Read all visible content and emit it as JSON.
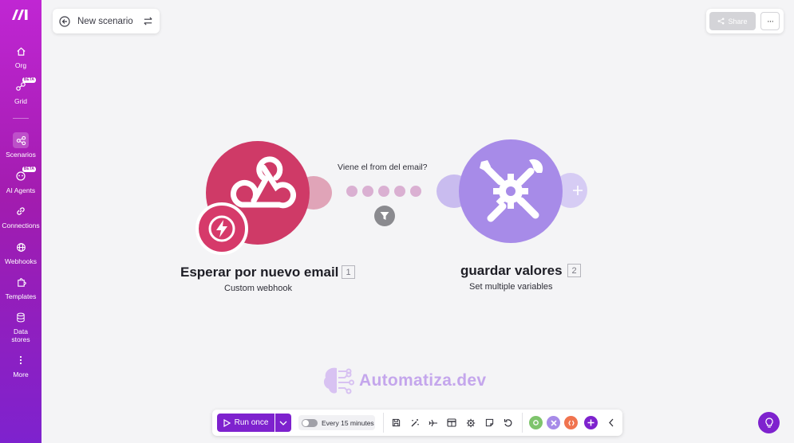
{
  "sidebar": {
    "items": [
      {
        "label": "Org",
        "icon": "home-icon"
      },
      {
        "label": "Grid",
        "icon": "grid-icon",
        "badge": "BETA"
      },
      {
        "label": "Scenarios",
        "icon": "scenarios-icon",
        "active": true
      },
      {
        "label": "AI Agents",
        "icon": "ai-agent-icon",
        "badge": "BETA"
      },
      {
        "label": "Connections",
        "icon": "link-icon"
      },
      {
        "label": "Webhooks",
        "icon": "globe-icon"
      },
      {
        "label": "Templates",
        "icon": "puzzle-icon"
      },
      {
        "label": "Data stores",
        "icon": "database-icon"
      },
      {
        "label": "More",
        "icon": "more-vertical-icon"
      }
    ]
  },
  "header": {
    "scenario_name": "New scenario",
    "share_label": "Share",
    "more_label": "···"
  },
  "canvas": {
    "module1": {
      "title": "Esperar por nuevo email",
      "number": "1",
      "subtitle": "Custom webhook",
      "color": "#cf3a67"
    },
    "route": {
      "label": "Viene el from del email?"
    },
    "module2": {
      "title": "guardar valores",
      "number": "2",
      "subtitle": "Set multiple variables",
      "color": "#a78be8"
    }
  },
  "watermark": {
    "text": "Automatiza.dev"
  },
  "toolbar": {
    "run_label": "Run once",
    "schedule_label": "Every 15 minutes",
    "accent": "#7e22ce"
  }
}
